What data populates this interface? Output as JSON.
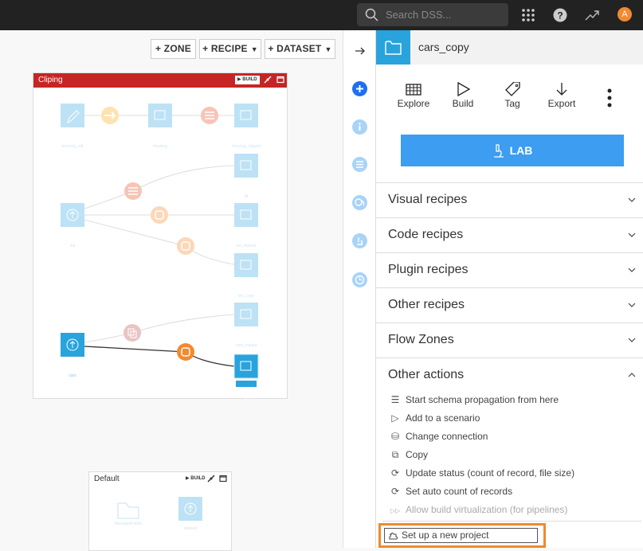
{
  "topbar": {
    "search_placeholder": "Search DSS...",
    "avatar_initial": "A",
    "icons": [
      "search-icon",
      "apps-grid-icon",
      "help-icon",
      "trending-icon",
      "avatar"
    ]
  },
  "flow_toolbar": {
    "zone_label": "+ ZONE",
    "recipe_label": "+ RECIPE",
    "dataset_label": "+ DATASET",
    "caret": "▼"
  },
  "zones": [
    {
      "name": "Cliping",
      "build_label": "▶ BUILD",
      "color": "#c62525",
      "nodes": [
        {
          "label": "housing_edt",
          "kind": "dataset-edit"
        },
        {
          "label": "",
          "kind": "recipe-sync"
        },
        {
          "label": "housing",
          "kind": "dataset"
        },
        {
          "label": "",
          "kind": "recipe-stack"
        },
        {
          "label": "housing_clipped",
          "kind": "dataset"
        },
        {
          "label": "iris",
          "kind": "dataset-upload"
        },
        {
          "label": "",
          "kind": "recipe-stack"
        },
        {
          "label": "",
          "kind": "recipe-python"
        },
        {
          "label": "",
          "kind": "recipe-python"
        },
        {
          "label": "df",
          "kind": "dataset"
        },
        {
          "label": "iris_clipped",
          "kind": "dataset"
        },
        {
          "label": "iris_copy",
          "kind": "dataset"
        },
        {
          "label": "cars",
          "kind": "dataset-upload"
        },
        {
          "label": "",
          "kind": "recipe-copy"
        },
        {
          "label": "",
          "kind": "recipe-python"
        },
        {
          "label": "cars_copied",
          "kind": "dataset"
        },
        {
          "label": "cars_copy",
          "kind": "dataset-selected"
        }
      ]
    },
    {
      "name": "Default",
      "build_label": "▶ BUILD",
      "nodes": [
        {
          "label": "ManagedFolder",
          "kind": "folder"
        },
        {
          "label": "dataset",
          "kind": "dataset-upload"
        }
      ]
    }
  ],
  "panel": {
    "title": "cars_copy",
    "actions": [
      {
        "label": "Explore",
        "icon": "table-icon"
      },
      {
        "label": "Build",
        "icon": "play-icon"
      },
      {
        "label": "Tag",
        "icon": "tag-icon"
      },
      {
        "label": "Export",
        "icon": "arrow-down-icon"
      }
    ],
    "lab_label": "LAB",
    "sections": [
      {
        "label": "Visual recipes",
        "expanded": false
      },
      {
        "label": "Code recipes",
        "expanded": false
      },
      {
        "label": "Plugin recipes",
        "expanded": false
      },
      {
        "label": "Other recipes",
        "expanded": false
      },
      {
        "label": "Flow Zones",
        "expanded": false
      },
      {
        "label": "Other actions",
        "expanded": true
      }
    ],
    "other_actions": [
      {
        "label": "Start schema propagation from here",
        "icon": "list-icon",
        "glyph": "☰",
        "disabled": false
      },
      {
        "label": "Add to a scenario",
        "icon": "play-outline-icon",
        "glyph": "▷",
        "disabled": false
      },
      {
        "label": "Change connection",
        "icon": "database-icon",
        "glyph": "⛁",
        "disabled": false
      },
      {
        "label": "Copy",
        "icon": "copy-icon",
        "glyph": "⧉",
        "disabled": false
      },
      {
        "label": "Update status (count of record, file size)",
        "icon": "refresh-icon",
        "glyph": "⟳",
        "disabled": false
      },
      {
        "label": "Set auto count of records",
        "icon": "refresh-icon",
        "glyph": "⟳",
        "disabled": false
      },
      {
        "label": "Allow build virtualization (for pipelines)",
        "icon": "fast-forward-icon",
        "glyph": "▷▷",
        "disabled": true
      }
    ],
    "setup_label": "Set up a new project"
  }
}
